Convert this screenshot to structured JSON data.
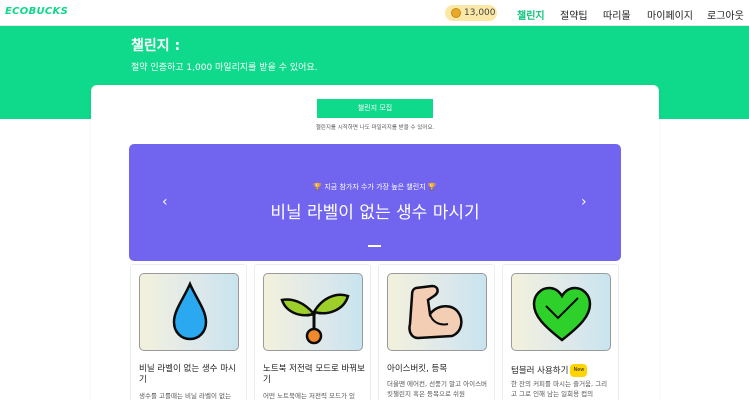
{
  "nav": {
    "logo": "ECOBUCKS",
    "coins": "13,000",
    "items": [
      "챌린지",
      "절약팁",
      "따리몰",
      "마이페이지",
      "로그아웃"
    ]
  },
  "hero": {
    "title": "챌린지 :",
    "subtitle": "절약 인증하고 1,000 마일리지를 받을 수 있어요."
  },
  "recruit": {
    "button": "챌린지 모집",
    "note": "챌린지를 시작하면 나도 마일리지를 받을 수 있어요."
  },
  "carousel": {
    "caption": "🏆 지금 참가자 수가 가장 높은 챌린지 🏆",
    "title": "비닐 라벨이 없는 생수 마시기",
    "prev": "‹",
    "next": "›"
  },
  "cards": [
    {
      "title": "비닐 라벨이 없는 생수 마시기",
      "desc": "생수를 고를때는 비닐 라벨이 없는",
      "badge": "",
      "icon": "water-drop-icon"
    },
    {
      "title": "노트북 저전력 모드로 바꿔보기",
      "desc": "어떤 노트북에는 저전력 모드가 있",
      "badge": "",
      "icon": "sprout-icon"
    },
    {
      "title": "아이스버킷, 등목",
      "desc": "더울땐 에어컨, 선풍기 말고 아이스버킷챌린지 혹은 등목으로 쉬원",
      "badge": "",
      "icon": "flexed-arm-icon"
    },
    {
      "title": "텀블러 사용하기",
      "desc": "한 잔의 커피를 마시는 즐거움, 그리고 그로 인해 남는 일회용 컵의",
      "badge": "New",
      "icon": "green-heart-icon"
    }
  ],
  "colors": {
    "brand": "#0fd98b",
    "carousel": "#7165f0",
    "coin_bg": "#fbe8a6"
  }
}
